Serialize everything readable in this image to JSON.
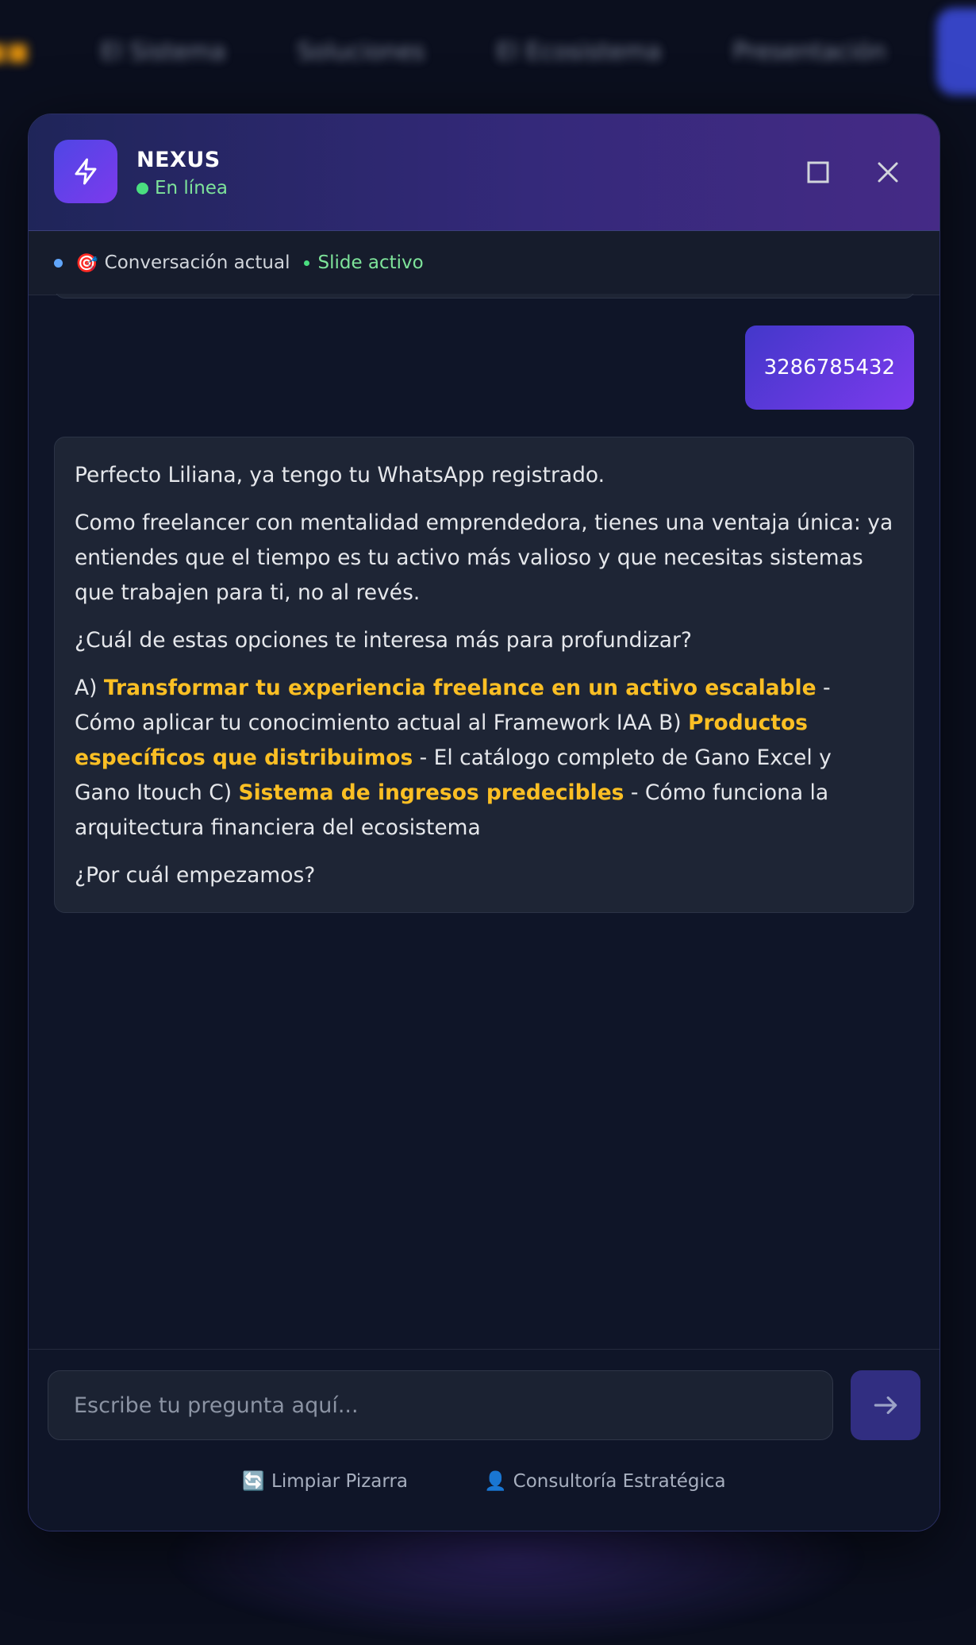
{
  "background": {
    "nav_items": [
      "El Sistema",
      "Soluciones",
      "El Ecosistema",
      "Presentación"
    ]
  },
  "chat": {
    "title": "NEXUS",
    "status": "En línea",
    "context": {
      "conversation_label": "Conversación actual",
      "slide_label": "Slide activo"
    },
    "user_message": "3286785432",
    "bot": {
      "p1": "Perfecto Liliana, ya tengo tu WhatsApp registrado.",
      "p2": "Como freelancer con mentalidad emprendedora, tienes una ventaja única: ya entiendes que el tiempo es tu activo más valioso y que necesitas sistemas que trabajen para ti, no al revés.",
      "p3": "¿Cuál de estas opciones te interesa más para profundizar?",
      "opt_a_prefix": "A) ",
      "opt_a_title": "Transformar tu experiencia freelance en un activo escalable",
      "opt_a_desc": " - Cómo aplicar tu conocimiento actual al Framework IAA B) ",
      "opt_b_title": "Productos específicos que distribuimos",
      "opt_b_desc": " - El catálogo completo de Gano Excel y Gano Itouch C) ",
      "opt_c_title": "Sistema de ingresos predecibles",
      "opt_c_desc": " - Cómo funciona la arquitectura financiera del ecosistema",
      "p5": "¿Por cuál empezamos?"
    },
    "input_placeholder": "Escribe tu pregunta aquí...",
    "clear_label": "Limpiar Pizarra",
    "consult_label": "Consultoría Estratégica",
    "colors": {
      "accent": "#4f46e5",
      "highlight": "#fbbf24",
      "online": "#4ade80"
    }
  }
}
